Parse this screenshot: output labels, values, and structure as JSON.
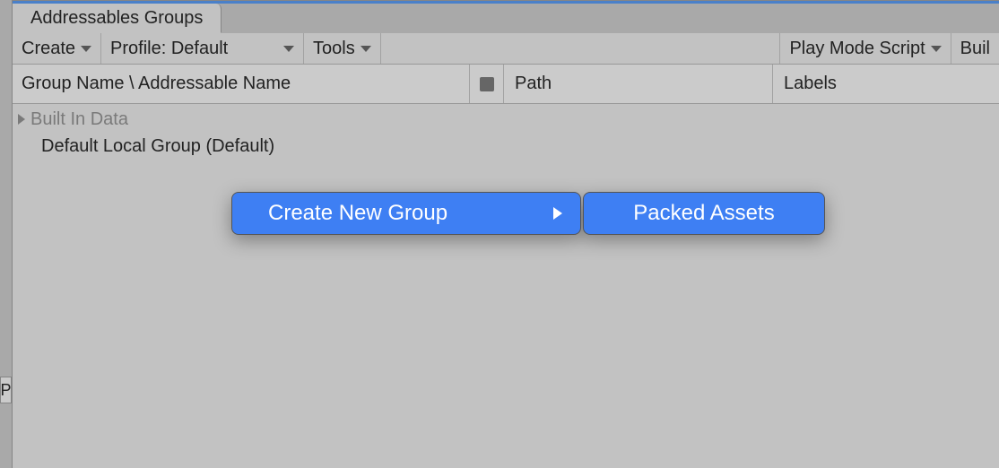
{
  "tab": {
    "title": "Addressables Groups"
  },
  "toolbar": {
    "create": "Create",
    "profile": "Profile: Default",
    "tools": "Tools",
    "playmode": "Play Mode Script",
    "build": "Buil"
  },
  "columns": {
    "name": "Group Name \\ Addressable Name",
    "path": "Path",
    "labels": "Labels"
  },
  "rows": {
    "builtin": "Built In Data",
    "default": "Default Local Group (Default)"
  },
  "menu": {
    "create_group": "Create New Group",
    "packed": "Packed Assets"
  },
  "stub": "P"
}
